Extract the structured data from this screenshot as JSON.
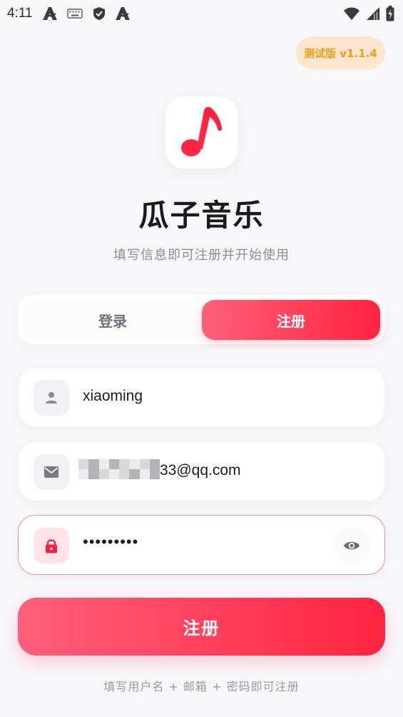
{
  "status_bar": {
    "time": "4:11",
    "icons": [
      "a-accessibility-icon",
      "keyboard-icon",
      "shield-check-icon",
      "a-accessibility-icon",
      "wifi-icon",
      "signal-icon",
      "battery-icon"
    ]
  },
  "version_badge": "测试版 v1.1.4",
  "app": {
    "title": "瓜子音乐",
    "subtitle": "填写信息即可注册并开始使用",
    "logo_icon": "music-note-icon",
    "accent_color": "#ff2d4b"
  },
  "tabs": [
    {
      "label": "登录",
      "active": false
    },
    {
      "label": "注册",
      "active": true
    }
  ],
  "form": {
    "username": {
      "icon": "person-icon",
      "value": "xiaoming"
    },
    "email": {
      "icon": "mail-icon",
      "value_visible": "33@qq.com"
    },
    "password": {
      "icon": "lock-icon",
      "value": "•••••••••",
      "toggle_icon": "eye-icon"
    }
  },
  "submit_label": "注册",
  "hint": "填写用户名 + 邮箱 + 密码即可注册"
}
